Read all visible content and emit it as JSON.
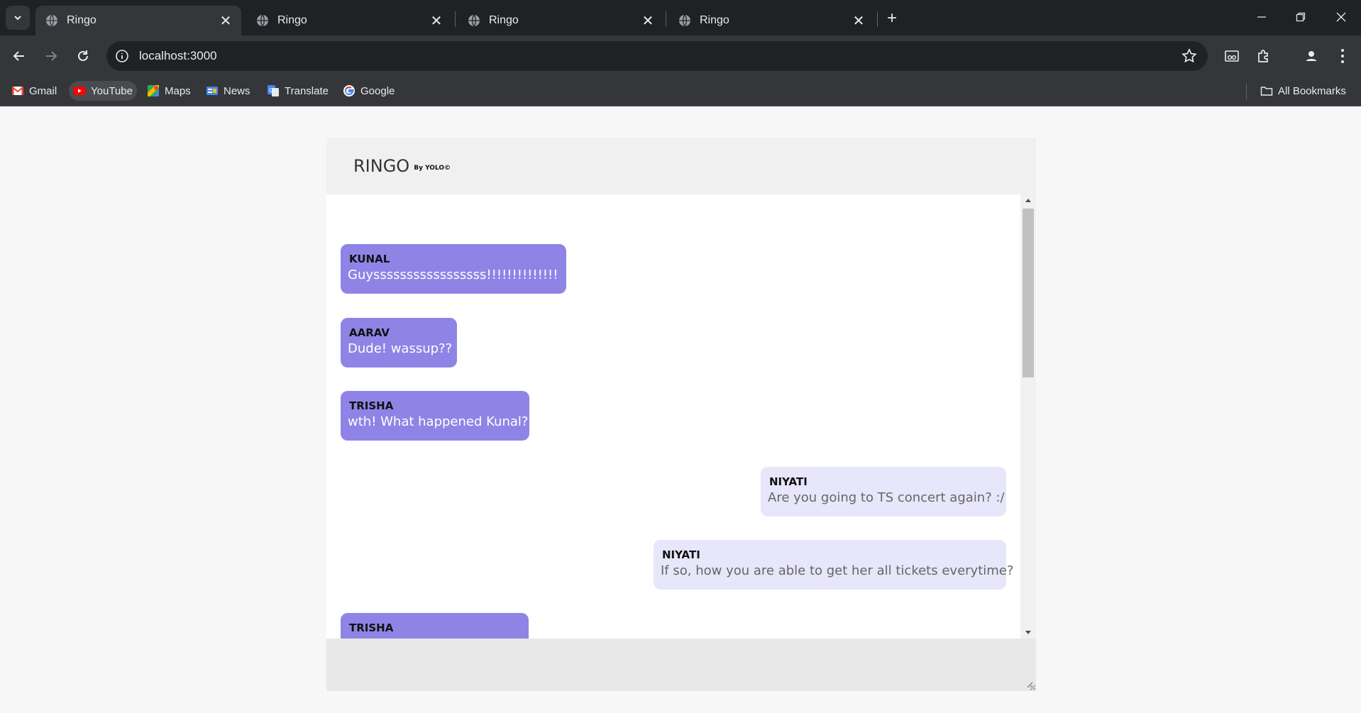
{
  "browser": {
    "tabs": [
      {
        "title": "Ringo",
        "active": true
      },
      {
        "title": "Ringo",
        "active": false
      },
      {
        "title": "Ringo",
        "active": false
      },
      {
        "title": "Ringo",
        "active": false
      }
    ],
    "url": "localhost:3000",
    "bookmarks": [
      {
        "label": "Gmail",
        "icon": "gmail-icon"
      },
      {
        "label": "YouTube",
        "icon": "youtube-icon"
      },
      {
        "label": "Maps",
        "icon": "maps-icon"
      },
      {
        "label": "News",
        "icon": "news-icon"
      },
      {
        "label": "Translate",
        "icon": "translate-icon"
      },
      {
        "label": "Google",
        "icon": "google-icon"
      }
    ],
    "all_bookmarks": "All Bookmarks"
  },
  "app": {
    "brand": "RINGO",
    "byline": "By YOLO©",
    "accent_other": "#8f84e6",
    "accent_self": "#e7e6fa",
    "messages": [
      {
        "sender": "KUNAL",
        "text": "Guysssssssssssssssss!!!!!!!!!!!!!!",
        "side": "other"
      },
      {
        "sender": "AARAV",
        "text": "Dude! wassup??",
        "side": "other"
      },
      {
        "sender": "TRISHA",
        "text": "wth! What happened Kunal?",
        "side": "other"
      },
      {
        "sender": "NIYATI",
        "text": "Are you going to TS concert again? :/",
        "side": "self"
      },
      {
        "sender": "NIYATI",
        "text": "If so, how you are able to get her all tickets everytime?",
        "side": "self"
      },
      {
        "sender": "TRISHA",
        "text": "",
        "side": "other"
      }
    ]
  }
}
